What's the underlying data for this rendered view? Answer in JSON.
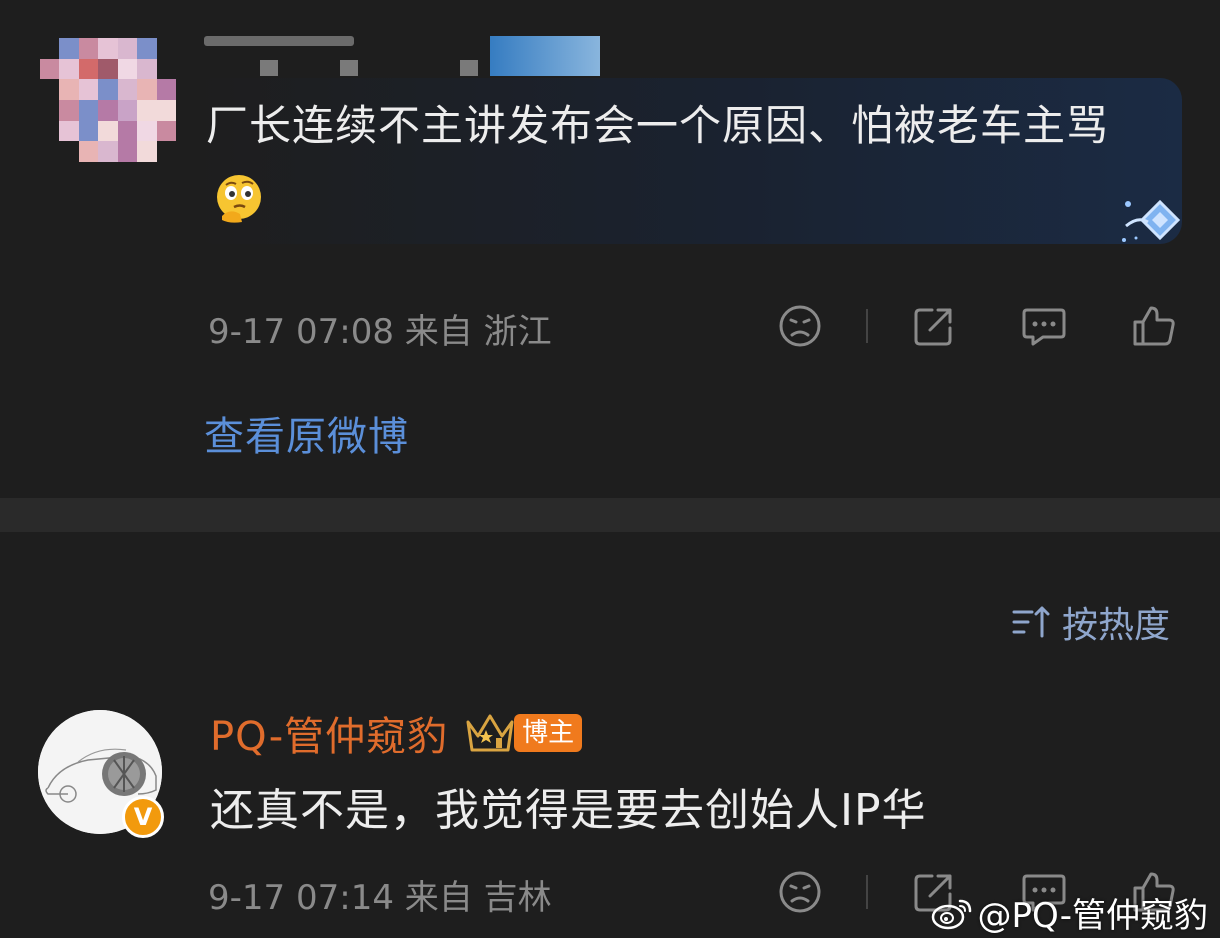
{
  "post": {
    "text": "厂长连续不主讲发布会一个原因、怕被老车主骂",
    "timestamp": "9-17 07:08",
    "source_prefix": "来自",
    "location": "浙江",
    "view_original": "查看原微博"
  },
  "sort": {
    "label": "按热度"
  },
  "comment": {
    "author": "PQ-管仲窥豹",
    "tag": "博主",
    "verified_badge": "V",
    "text": "还真不是，我觉得是要去创始人IP华",
    "timestamp": "9-17 07:14",
    "source_prefix": "来自",
    "location": "吉林"
  },
  "watermark": {
    "text": "@PQ-管仲窥豹"
  },
  "colors": {
    "background": "#1e1e1e",
    "link_blue": "#5b8fd9",
    "author_orange": "#e06c2c",
    "meta_gray": "#8a8a8a"
  },
  "icons": [
    "sad-face-icon",
    "share-icon",
    "comment-icon",
    "thumbs-up-icon",
    "sort-icon",
    "crown-icon",
    "weibo-logo-icon",
    "thinking-emoji-icon"
  ]
}
